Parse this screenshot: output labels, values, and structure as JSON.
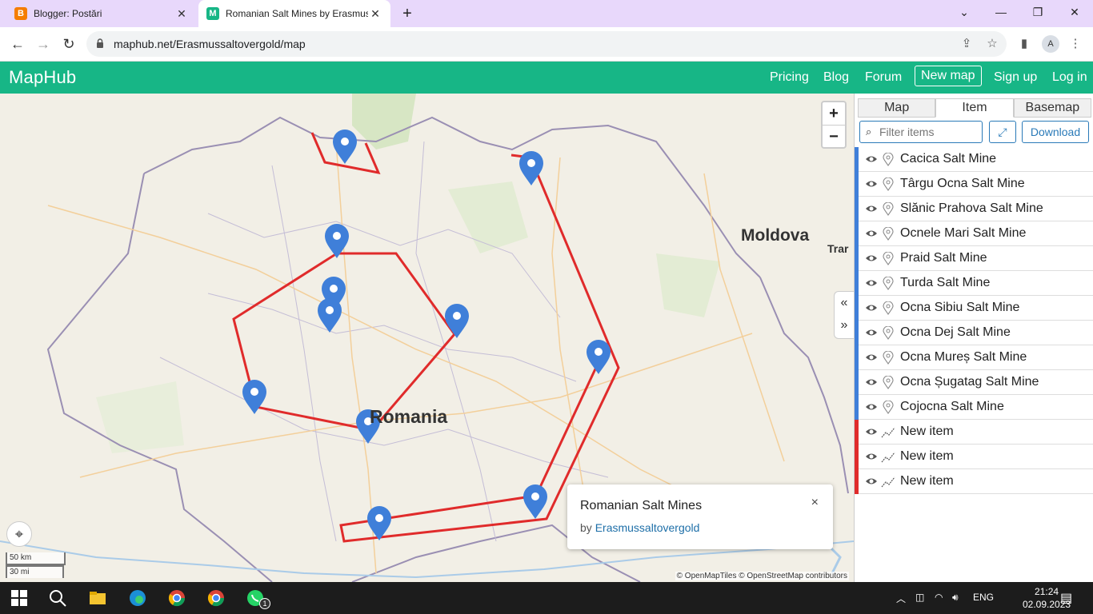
{
  "browser": {
    "tabs": [
      {
        "title": "Blogger: Postări",
        "favicon": "blogger-icon",
        "favicon_color": "#f57d00",
        "favicon_letter": "B"
      },
      {
        "title": "Romanian Salt Mines by Erasmus",
        "favicon": "maphub-icon",
        "favicon_color": "#17b686",
        "favicon_letter": "M"
      }
    ],
    "url": "maphub.net/Erasmussaltovergold/map",
    "profile_initial": "A"
  },
  "site": {
    "brand": "MapHub",
    "nav": [
      "Pricing",
      "Blog",
      "Forum",
      "New map",
      "Sign up",
      "Log in"
    ],
    "accent": "#17b686"
  },
  "map": {
    "country_labels": {
      "romania": "Romania",
      "moldova": "Moldova",
      "partial": "Trar"
    },
    "zoom_in": "+",
    "zoom_out": "−",
    "scale_km": "50 km",
    "scale_mi": "30 mi",
    "attribution": "© OpenMapTiles © OpenStreetMap contributors",
    "line_color": "#e02b2b",
    "marker_color": "#3f7fd9",
    "popup": {
      "title": "Romanian Salt Mines",
      "by": "by",
      "author": "Erasmussaltovergold",
      "close": "×"
    }
  },
  "panel": {
    "tabs": [
      "Map",
      "Item",
      "Basemap"
    ],
    "active_tab": "Item",
    "filter_placeholder": "Filter items",
    "download": "Download",
    "items": [
      {
        "name": "Cacica Salt Mine",
        "kind": "marker"
      },
      {
        "name": "Târgu Ocna Salt Mine",
        "kind": "marker"
      },
      {
        "name": "Slănic Prahova Salt Mine",
        "kind": "marker"
      },
      {
        "name": "Ocnele Mari Salt Mine",
        "kind": "marker"
      },
      {
        "name": "Praid Salt Mine",
        "kind": "marker"
      },
      {
        "name": "Turda Salt Mine",
        "kind": "marker"
      },
      {
        "name": "Ocna Sibiu Salt Mine",
        "kind": "marker"
      },
      {
        "name": "Ocna Dej Salt Mine",
        "kind": "marker"
      },
      {
        "name": "Ocna Mureș Salt Mine",
        "kind": "marker"
      },
      {
        "name": "Ocna Șugatag Salt Mine",
        "kind": "marker"
      },
      {
        "name": "Cojocna Salt Mine",
        "kind": "marker"
      },
      {
        "name": "New item",
        "kind": "line"
      },
      {
        "name": "New item",
        "kind": "line"
      },
      {
        "name": "New item",
        "kind": "line"
      }
    ]
  },
  "taskbar": {
    "language": "ENG",
    "time": "21:24",
    "date": "02.09.2023",
    "whatsapp_badge": "1"
  }
}
